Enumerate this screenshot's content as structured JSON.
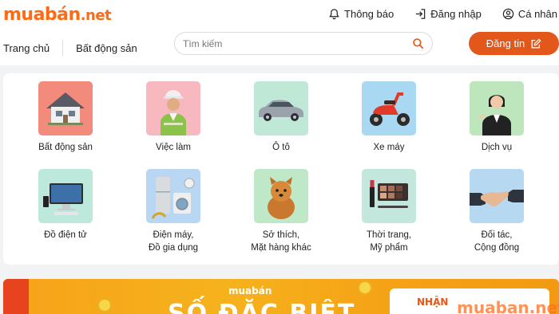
{
  "brand": {
    "logo_main": "muabán",
    "logo_tld": ".net",
    "accent": "#e4571a"
  },
  "top_links": [
    {
      "label": "Thông báo",
      "icon": "bell-icon"
    },
    {
      "label": "Đăng nhập",
      "icon": "login-icon"
    },
    {
      "label": "Cá nhân",
      "icon": "user-icon"
    }
  ],
  "nav": {
    "home": "Trang chủ",
    "real_estate": "Bất động sản"
  },
  "search": {
    "placeholder": "Tìm kiếm",
    "value": ""
  },
  "post_button": {
    "label": "Đăng tin",
    "icon": "edit-icon"
  },
  "categories": [
    {
      "label": "Bất động sản",
      "icon": "house-icon",
      "bg": "#f28b7c"
    },
    {
      "label": "Việc làm",
      "icon": "worker-icon",
      "bg": "#f8b8c0"
    },
    {
      "label": "Ô tô",
      "icon": "car-icon",
      "bg": "#bfe8d6"
    },
    {
      "label": "Xe máy",
      "icon": "scooter-icon",
      "bg": "#a9d8f2"
    },
    {
      "label": "Dịch vụ",
      "icon": "service-woman-icon",
      "bg": "#bde6bd"
    },
    {
      "label": "Đồ điện tử",
      "icon": "computer-icon",
      "bg": "#bde8dc"
    },
    {
      "label": "Điện máy,",
      "label2": "Đồ gia dụng",
      "icon": "appliances-icon",
      "bg": "#b9d6f2"
    },
    {
      "label": "Sở thích,",
      "label2": "Mặt hàng khác",
      "icon": "dog-icon",
      "bg": "#bfe8c8"
    },
    {
      "label": "Thời trang,",
      "label2": "Mỹ phẩm",
      "icon": "cosmetics-icon",
      "bg": "#c3e7dc"
    },
    {
      "label": "Đối tác,",
      "label2": "Cộng đồng",
      "icon": "handshake-icon",
      "bg": "#b6d8f0"
    }
  ],
  "banner": {
    "brand": "muabán",
    "headline": "SỐ ĐẶC BIỆT",
    "ticket_text": "NHẬN",
    "watermark": "muaban.net"
  }
}
